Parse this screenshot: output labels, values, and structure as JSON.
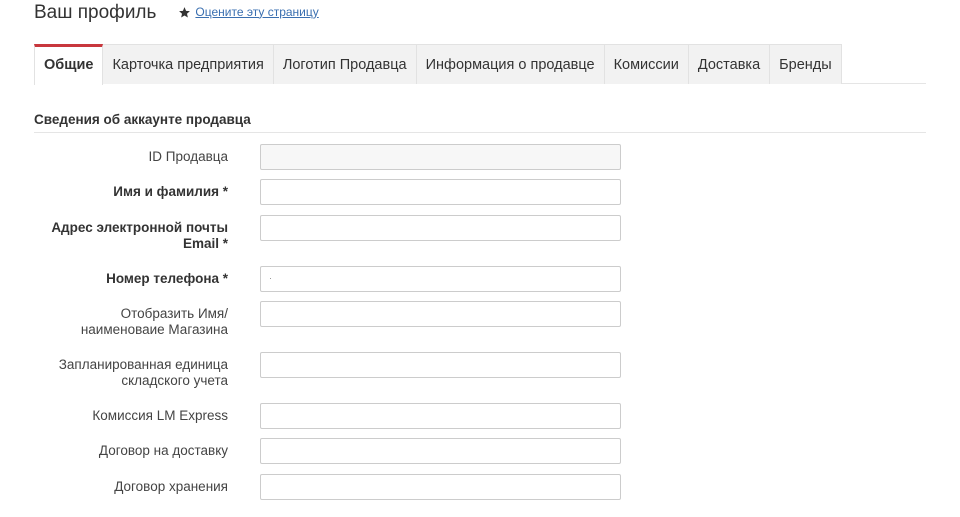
{
  "header": {
    "title": "Ваш профиль",
    "rate_link": "Оцените эту страницу",
    "rate_icon": "star-icon"
  },
  "tabs": [
    {
      "label": "Общие",
      "active": true
    },
    {
      "label": "Карточка предприятия",
      "active": false
    },
    {
      "label": "Логотип Продавца",
      "active": false
    },
    {
      "label": "Информация о продавце",
      "active": false
    },
    {
      "label": "Комиссии",
      "active": false
    },
    {
      "label": "Доставка",
      "active": false
    },
    {
      "label": "Бренды",
      "active": false
    }
  ],
  "section": {
    "title": "Сведения об аккаунте продавца"
  },
  "fields": [
    {
      "label_lines": [
        "ID Продавца"
      ],
      "required": false,
      "value": ""
    },
    {
      "label_lines": [
        "Имя и фамилия *"
      ],
      "required": true,
      "value": ""
    },
    {
      "label_lines": [
        "Адрес электронной почты",
        "Email *"
      ],
      "required": true,
      "value": ""
    },
    {
      "label_lines": [
        "Номер телефона *"
      ],
      "required": true,
      "value": ""
    },
    {
      "label_lines": [
        "Отобразить Имя/",
        "наименоваие Магазина"
      ],
      "required": false,
      "value": ""
    },
    {
      "label_lines": [
        "Запланированная единица",
        "складского учета"
      ],
      "required": false,
      "value": ""
    },
    {
      "label_lines": [
        "Комиссия LM Express"
      ],
      "required": false,
      "value": ""
    },
    {
      "label_lines": [
        "Договор на доставку"
      ],
      "required": false,
      "value": ""
    },
    {
      "label_lines": [
        "Договор хранения"
      ],
      "required": false,
      "value": ""
    }
  ],
  "colors": {
    "active_tab_accent": "#c8373d",
    "link": "#3a6fb0"
  }
}
